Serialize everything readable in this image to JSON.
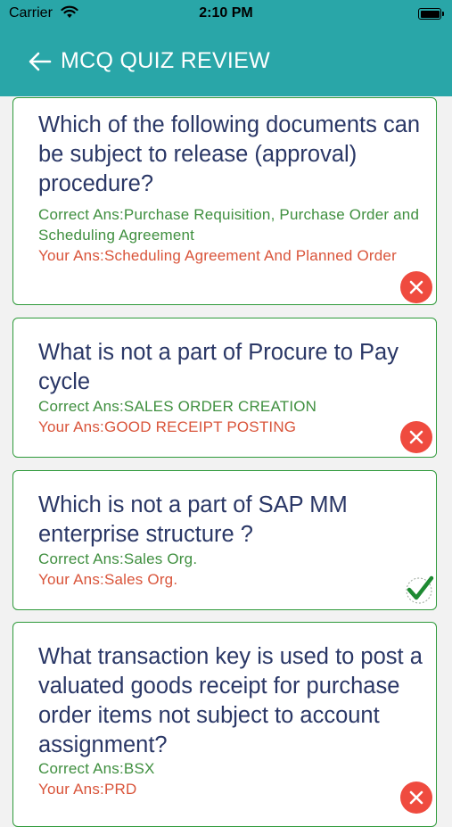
{
  "status": {
    "carrier": "Carrier",
    "time": "2:10 PM"
  },
  "header": {
    "title": "MCQ QUIZ REVIEW"
  },
  "questions": [
    {
      "question": "Which of the following documents can be subject to release (approval) procedure?",
      "correct": "Correct Ans:Purchase Requisition, Purchase Order and Scheduling Agreement",
      "yours": "Your Ans:Scheduling Agreement  And Planned Order",
      "result_icon": "close-icon"
    },
    {
      "question": "What is not a part of Procure to Pay cycle",
      "correct": "Correct Ans:SALES ORDER CREATION",
      "yours": "Your Ans:GOOD RECEIPT POSTING",
      "result_icon": "close-icon"
    },
    {
      "question": "Which is not a part of SAP MM enterprise structure ?",
      "correct": "Correct Ans:Sales Org.",
      "yours": "Your Ans:Sales Org.",
      "result_icon": "check-icon"
    },
    {
      "question": "What transaction key is used to post a valuated goods receipt for purchase order items not subject to account assignment?",
      "correct": "Correct Ans:BSX",
      "yours": "Your Ans:PRD",
      "result_icon": "close-icon"
    }
  ],
  "colors": {
    "header": "#29a6a8",
    "border": "#2e9a3a",
    "correct": "#3f8f3f",
    "wrong": "#d9543a",
    "badge_wrong": "#ef4b3f",
    "question": "#2a3766"
  }
}
